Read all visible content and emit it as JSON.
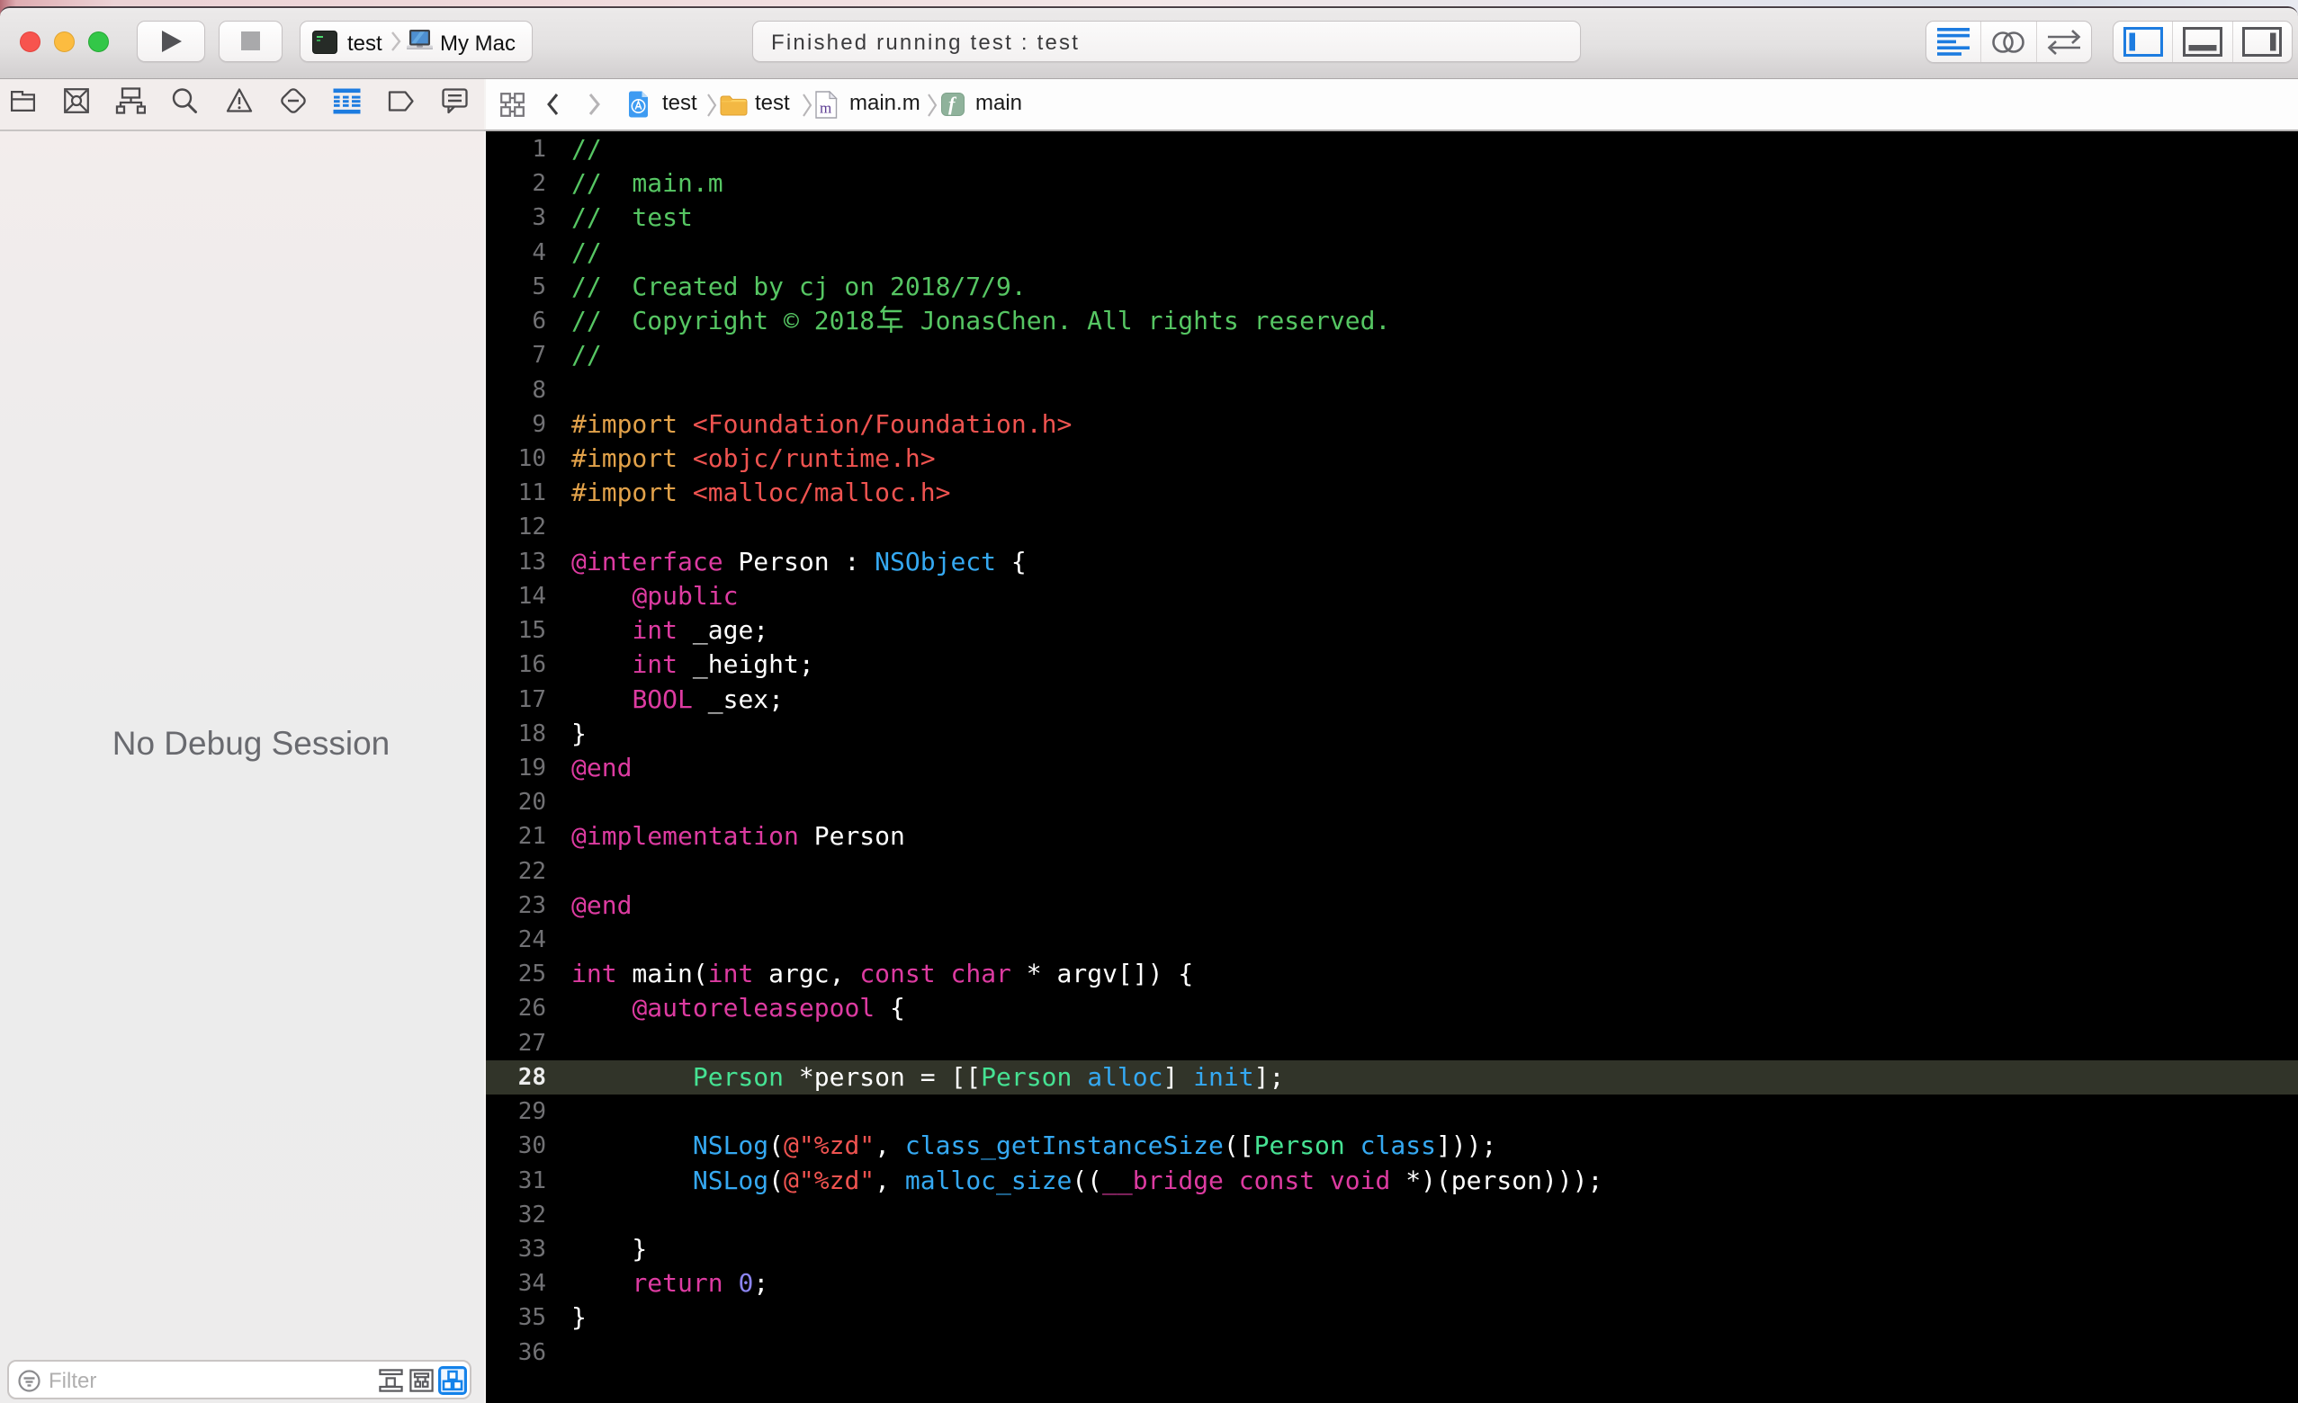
{
  "window_title_bar": {
    "traffic_lights": [
      "close",
      "minimize",
      "zoom"
    ],
    "run_button": "run",
    "stop_button": "stop",
    "scheme": {
      "project": "test",
      "device": "My Mac"
    },
    "status_message": "Finished running test : test",
    "editor_mode_buttons": [
      "standard-editor",
      "assistant-editor",
      "version-editor"
    ],
    "panel_toggle_buttons": [
      "navigator-panel",
      "debug-area",
      "utilities-panel"
    ]
  },
  "navigator_bar": {
    "items": [
      {
        "name": "project-navigator",
        "icon": "folder",
        "selected": false
      },
      {
        "name": "source-control-navigator",
        "icon": "source-control",
        "selected": false
      },
      {
        "name": "symbol-navigator",
        "icon": "symbol",
        "selected": false
      },
      {
        "name": "find-navigator",
        "icon": "search",
        "selected": false
      },
      {
        "name": "issue-navigator",
        "icon": "warning",
        "selected": false
      },
      {
        "name": "test-navigator",
        "icon": "diamond",
        "selected": false
      },
      {
        "name": "debug-navigator",
        "icon": "threads",
        "selected": true
      },
      {
        "name": "breakpoint-navigator",
        "icon": "breakpoint",
        "selected": false
      },
      {
        "name": "report-navigator",
        "icon": "report",
        "selected": false
      }
    ]
  },
  "jump_bar": {
    "related_items_icon": "related-items",
    "back_enabled": true,
    "forward_enabled": false,
    "crumbs": [
      {
        "icon": "project-doc",
        "label": "test"
      },
      {
        "icon": "folder",
        "label": "test"
      },
      {
        "icon": "m-file",
        "label": "main.m"
      },
      {
        "icon": "function",
        "label": "main"
      }
    ]
  },
  "debug_sidebar": {
    "empty_text": "No Debug Session",
    "filter_placeholder": "Filter",
    "view_buttons": [
      "view-flat",
      "view-grouped",
      "view-hierarchy"
    ],
    "selected_view": "view-hierarchy"
  },
  "editor": {
    "current_line": 28,
    "lines": [
      {
        "n": 1,
        "current": false,
        "tokens": [
          {
            "t": "c",
            "x": "//"
          }
        ]
      },
      {
        "n": 2,
        "current": false,
        "tokens": [
          {
            "t": "c",
            "x": "//  main.m"
          }
        ]
      },
      {
        "n": 3,
        "current": false,
        "tokens": [
          {
            "t": "c",
            "x": "//  test"
          }
        ]
      },
      {
        "n": 4,
        "current": false,
        "tokens": [
          {
            "t": "c",
            "x": "//"
          }
        ]
      },
      {
        "n": 5,
        "current": false,
        "tokens": [
          {
            "t": "c",
            "x": "//  Created by cj on 2018/7/9."
          }
        ]
      },
      {
        "n": 6,
        "current": false,
        "tokens": [
          {
            "t": "c",
            "x": "//  Copyright © 2018年 JonasChen. All rights reserved."
          }
        ]
      },
      {
        "n": 7,
        "current": false,
        "tokens": [
          {
            "t": "c",
            "x": "//"
          }
        ]
      },
      {
        "n": 8,
        "current": false,
        "tokens": []
      },
      {
        "n": 9,
        "current": false,
        "tokens": [
          {
            "t": "p",
            "x": "#import"
          },
          {
            "t": "w",
            "x": " "
          },
          {
            "t": "s",
            "x": "<Foundation/Foundation.h>"
          }
        ]
      },
      {
        "n": 10,
        "current": false,
        "tokens": [
          {
            "t": "p",
            "x": "#import"
          },
          {
            "t": "w",
            "x": " "
          },
          {
            "t": "s",
            "x": "<objc/runtime.h>"
          }
        ]
      },
      {
        "n": 11,
        "current": false,
        "tokens": [
          {
            "t": "p",
            "x": "#import"
          },
          {
            "t": "w",
            "x": " "
          },
          {
            "t": "s",
            "x": "<malloc/malloc.h>"
          }
        ]
      },
      {
        "n": 12,
        "current": false,
        "tokens": []
      },
      {
        "n": 13,
        "current": false,
        "tokens": [
          {
            "t": "k",
            "x": "@interface"
          },
          {
            "t": "w",
            "x": " Person : "
          },
          {
            "t": "t",
            "x": "NSObject"
          },
          {
            "t": "w",
            "x": " {"
          }
        ]
      },
      {
        "n": 14,
        "current": false,
        "tokens": [
          {
            "t": "w",
            "x": "    "
          },
          {
            "t": "k",
            "x": "@public"
          }
        ]
      },
      {
        "n": 15,
        "current": false,
        "tokens": [
          {
            "t": "w",
            "x": "    "
          },
          {
            "t": "k",
            "x": "int"
          },
          {
            "t": "w",
            "x": " _age;"
          }
        ]
      },
      {
        "n": 16,
        "current": false,
        "tokens": [
          {
            "t": "w",
            "x": "    "
          },
          {
            "t": "k",
            "x": "int"
          },
          {
            "t": "w",
            "x": " _height;"
          }
        ]
      },
      {
        "n": 17,
        "current": false,
        "tokens": [
          {
            "t": "w",
            "x": "    "
          },
          {
            "t": "k",
            "x": "BOOL"
          },
          {
            "t": "w",
            "x": " _sex;"
          }
        ]
      },
      {
        "n": 18,
        "current": false,
        "tokens": [
          {
            "t": "w",
            "x": "}"
          }
        ]
      },
      {
        "n": 19,
        "current": false,
        "tokens": [
          {
            "t": "k",
            "x": "@end"
          }
        ]
      },
      {
        "n": 20,
        "current": false,
        "tokens": []
      },
      {
        "n": 21,
        "current": false,
        "tokens": [
          {
            "t": "k",
            "x": "@implementation"
          },
          {
            "t": "w",
            "x": " Person"
          }
        ]
      },
      {
        "n": 22,
        "current": false,
        "tokens": []
      },
      {
        "n": 23,
        "current": false,
        "tokens": [
          {
            "t": "k",
            "x": "@end"
          }
        ]
      },
      {
        "n": 24,
        "current": false,
        "tokens": []
      },
      {
        "n": 25,
        "current": false,
        "tokens": [
          {
            "t": "k",
            "x": "int"
          },
          {
            "t": "w",
            "x": " main("
          },
          {
            "t": "k",
            "x": "int"
          },
          {
            "t": "w",
            "x": " argc, "
          },
          {
            "t": "k",
            "x": "const"
          },
          {
            "t": "w",
            "x": " "
          },
          {
            "t": "k",
            "x": "char"
          },
          {
            "t": "w",
            "x": " * argv[]) {"
          }
        ]
      },
      {
        "n": 26,
        "current": false,
        "tokens": [
          {
            "t": "w",
            "x": "    "
          },
          {
            "t": "k",
            "x": "@autoreleasepool"
          },
          {
            "t": "w",
            "x": " {"
          }
        ]
      },
      {
        "n": 27,
        "current": false,
        "tokens": []
      },
      {
        "n": 28,
        "current": true,
        "tokens": [
          {
            "t": "w",
            "x": "        "
          },
          {
            "t": "g",
            "x": "Person"
          },
          {
            "t": "w",
            "x": " *person = [["
          },
          {
            "t": "g",
            "x": "Person"
          },
          {
            "t": "w",
            "x": " "
          },
          {
            "t": "f",
            "x": "alloc"
          },
          {
            "t": "w",
            "x": "] "
          },
          {
            "t": "f",
            "x": "init"
          },
          {
            "t": "w",
            "x": "];"
          }
        ]
      },
      {
        "n": 29,
        "current": false,
        "tokens": []
      },
      {
        "n": 30,
        "current": false,
        "tokens": [
          {
            "t": "w",
            "x": "        "
          },
          {
            "t": "f",
            "x": "NSLog"
          },
          {
            "t": "w",
            "x": "("
          },
          {
            "t": "s",
            "x": "@\"%zd\""
          },
          {
            "t": "w",
            "x": ", "
          },
          {
            "t": "f",
            "x": "class_getInstanceSize"
          },
          {
            "t": "w",
            "x": "(["
          },
          {
            "t": "g",
            "x": "Person"
          },
          {
            "t": "w",
            "x": " "
          },
          {
            "t": "f",
            "x": "class"
          },
          {
            "t": "w",
            "x": "]));"
          }
        ]
      },
      {
        "n": 31,
        "current": false,
        "tokens": [
          {
            "t": "w",
            "x": "        "
          },
          {
            "t": "f",
            "x": "NSLog"
          },
          {
            "t": "w",
            "x": "("
          },
          {
            "t": "s",
            "x": "@\"%zd\""
          },
          {
            "t": "w",
            "x": ", "
          },
          {
            "t": "f",
            "x": "malloc_size"
          },
          {
            "t": "w",
            "x": "(("
          },
          {
            "t": "k",
            "x": "__bridge"
          },
          {
            "t": "w",
            "x": " "
          },
          {
            "t": "k",
            "x": "const"
          },
          {
            "t": "w",
            "x": " "
          },
          {
            "t": "k",
            "x": "void"
          },
          {
            "t": "w",
            "x": " *)(person)));"
          }
        ]
      },
      {
        "n": 32,
        "current": false,
        "tokens": []
      },
      {
        "n": 33,
        "current": false,
        "tokens": [
          {
            "t": "w",
            "x": "    }"
          }
        ]
      },
      {
        "n": 34,
        "current": false,
        "tokens": [
          {
            "t": "w",
            "x": "    "
          },
          {
            "t": "k",
            "x": "return"
          },
          {
            "t": "w",
            "x": " "
          },
          {
            "t": "n",
            "x": "0"
          },
          {
            "t": "w",
            "x": ";"
          }
        ]
      },
      {
        "n": 35,
        "current": false,
        "tokens": [
          {
            "t": "w",
            "x": "}"
          }
        ]
      },
      {
        "n": 36,
        "current": false,
        "tokens": []
      }
    ]
  },
  "colors": {
    "accent_blue": "#1d7ce0",
    "editor_background": "#000000",
    "current_line_highlight": "#313429",
    "comment": "#56c663",
    "keyword": "#dd3ba1",
    "string": "#ef5350",
    "preprocessor": "#e2a24a",
    "class_system": "#35a9f2",
    "function": "#35a9f2",
    "class_project": "#46e293",
    "number": "#8b84f0",
    "plain": "#ffffff",
    "traffic_red": "#f7544e",
    "traffic_yellow": "#fcbc40",
    "traffic_green": "#33c748"
  }
}
